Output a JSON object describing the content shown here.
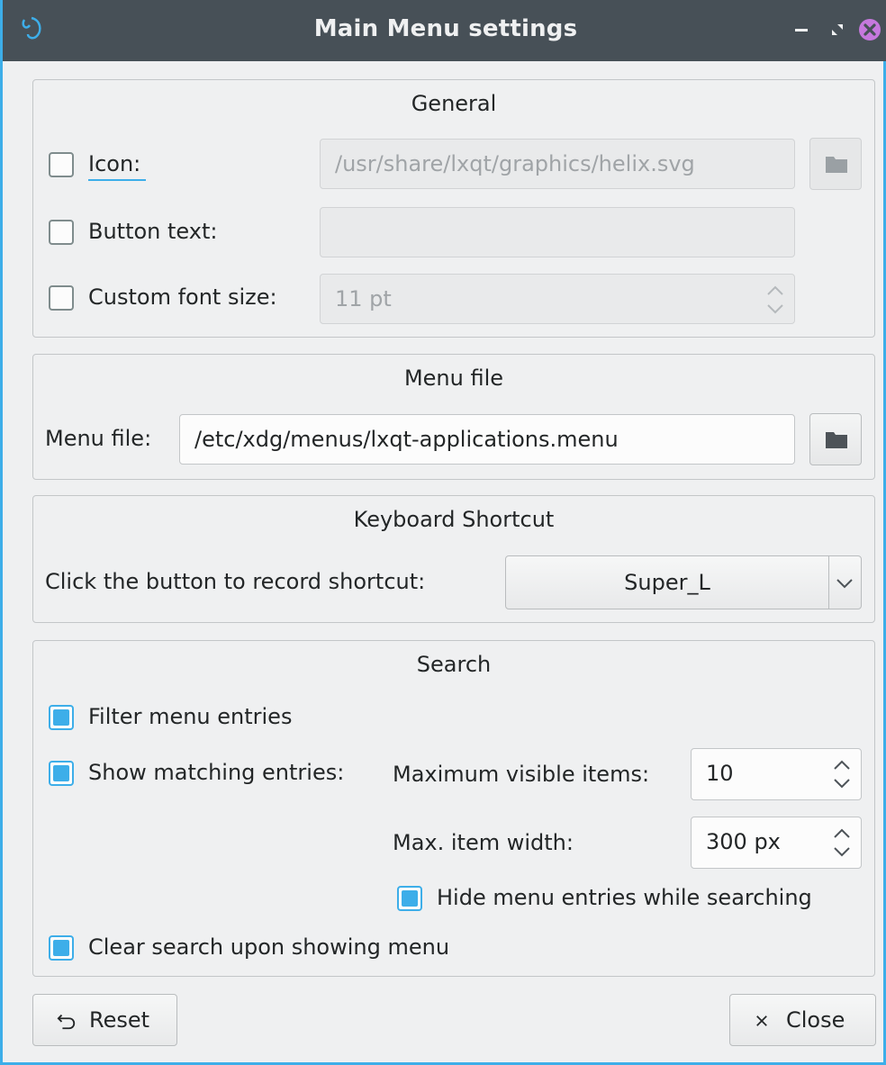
{
  "window": {
    "title": "Main Menu settings"
  },
  "general": {
    "title": "General",
    "icon_label": "Icon:",
    "icon_path": "/usr/share/lxqt/graphics/helix.svg",
    "icon_checked": false,
    "button_text_label": "Button text:",
    "button_text_value": "",
    "button_text_checked": false,
    "font_size_label": "Custom font size:",
    "font_size_value": "11 pt",
    "font_size_checked": false
  },
  "menu_file": {
    "title": "Menu file",
    "label": "Menu file:",
    "value": "/etc/xdg/menus/lxqt-applications.menu"
  },
  "shortcut": {
    "title": "Keyboard Shortcut",
    "label": "Click the button to record shortcut:",
    "value": "Super_L"
  },
  "search": {
    "title": "Search",
    "filter_label": "Filter menu entries",
    "filter_checked": true,
    "show_matching_label": "Show matching entries:",
    "show_matching_checked": true,
    "max_visible_label": "Maximum visible items:",
    "max_visible_value": "10",
    "max_width_label": "Max. item width:",
    "max_width_value": "300 px",
    "hide_label": "Hide menu entries while searching",
    "hide_checked": true,
    "clear_label": "Clear search upon showing menu",
    "clear_checked": true
  },
  "buttons": {
    "reset": "Reset",
    "close": "Close"
  },
  "colors": {
    "accent": "#3daee9",
    "titlebar": "#475057",
    "window_bg": "#eff0f1"
  }
}
